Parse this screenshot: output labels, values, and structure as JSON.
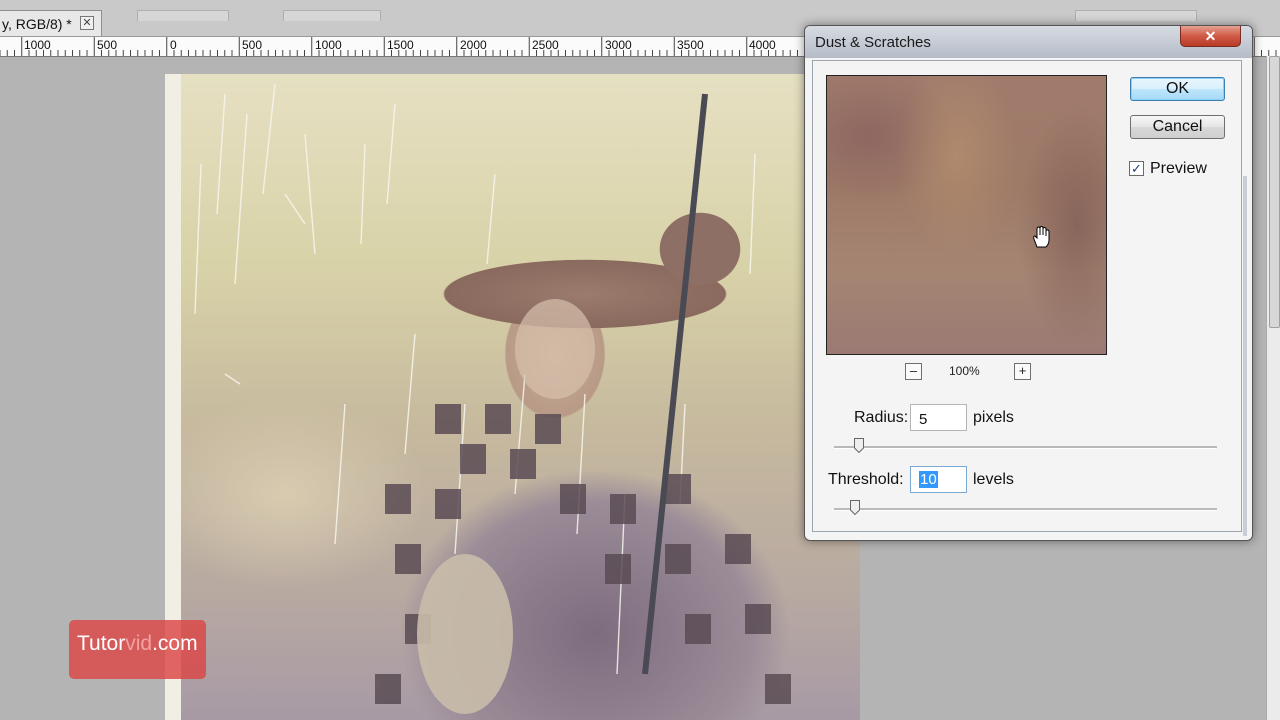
{
  "tab": {
    "title": "y, RGB/8) *",
    "close_label": "✕"
  },
  "ruler": {
    "labels": [
      "1000",
      "500",
      "0",
      "500",
      "1000",
      "1500",
      "2000",
      "2500",
      "3000",
      "3500",
      "4000"
    ]
  },
  "watermark": {
    "left": "Tutor",
    "mid": "vid",
    "right": ".com"
  },
  "dialog": {
    "title": "Dust & Scratches",
    "close_label": "✕",
    "ok_label": "OK",
    "cancel_label": "Cancel",
    "preview_label": "Preview",
    "preview_checked": true,
    "zoom_out_label": "–",
    "zoom_in_label": "+",
    "zoom_level": "100%",
    "radius": {
      "label": "Radius:",
      "value": "5",
      "unit": "pixels"
    },
    "threshold": {
      "label": "Threshold:",
      "value": "10",
      "unit": "levels"
    }
  },
  "colors": {
    "accent": "#3399ff",
    "close_button": "#c94a35"
  }
}
